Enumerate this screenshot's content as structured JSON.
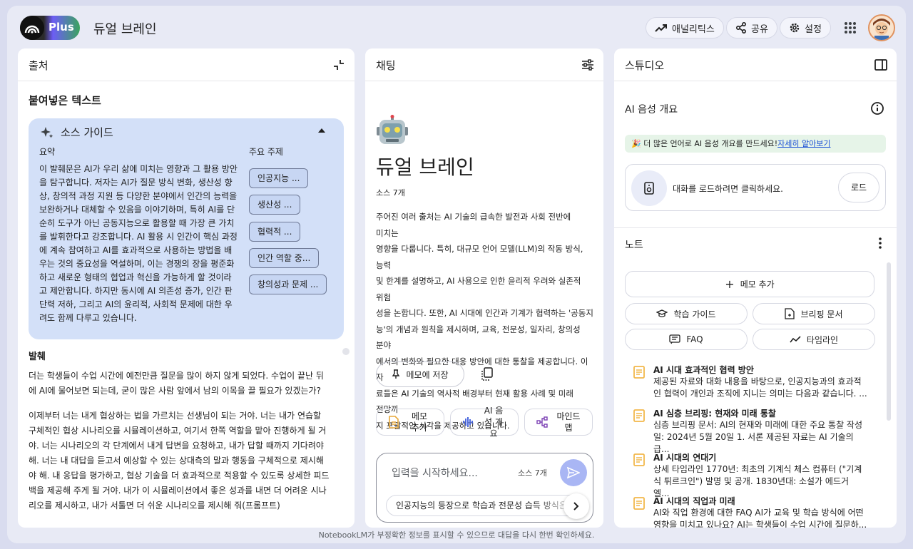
{
  "header": {
    "plan_badge": "Plus",
    "title": "듀얼 브레인",
    "analytics_label": "애널리틱스",
    "share_label": "공유",
    "settings_label": "설정"
  },
  "sources": {
    "panel_title": "출처",
    "pasted_title": "붙여넣은 텍스트",
    "guide_title": "소스 가이드",
    "summary_label": "요약",
    "topics_label": "주요 주제",
    "summary_lines": [
      "이 발췌문은 AI가 우리 삶에 미치는 영향과 그 활용 방안",
      "을 탐구합니다. 저자는 AI가 질문 방식 변화, 생산성 향",
      "상, 창의적 과정 지원 등 다양한 분야에서 인간의 능력을",
      "보완하거나 대체할 수 있음을 이야기하며, 특히 AI를 단",
      "순히 도구가 아닌 공동지능으로 활용할 때 가장 큰 가치",
      "를 발휘한다고 강조합니다. AI 활용 시 인간이 핵심 과정",
      "에 계속 참여하고 AI를 효과적으로 사용하는 방법을 배",
      "우는 것의 중요성을 역설하며, 이는 경쟁의 장을 평준화",
      "하고 새로운 형태의 협업과 혁신을 가능하게 할 것이라",
      "고 제안합니다. 하지만 동시에 AI 의존성 증가, 인간 판",
      "단력 저하, 그리고 AI의 윤리적, 사회적 문제에 대한 우",
      "려도 함께 다루고 있습니다."
    ],
    "topics": [
      "인공지능 ...",
      "생산성 ...",
      "협력적 ...",
      "인간 역할 중...",
      "창의성과 문제 ..."
    ],
    "body_label": "발췌",
    "body_paragraph_1": [
      "더는 학생들이 수업 시간에 예전만큼 질문을 많이 하지 않게 되었다. 수업이 끝난 뒤",
      "에 AI에 물어보면 되는데, 굳이 많은 사람 앞에서 남의 이목을 끌 필요가 있겠는가?"
    ],
    "body_paragraph_2": [
      "이제부터 너는 내게 협상하는 법을 가르치는 선생님이 되는 거야. 너는 내가 연습할",
      "구체적인 협상 시나리오를 시뮬레이션하고, 여기서 한쪽 역할을 맡아 진행하게 될 거",
      "야. 너는 시나리오의 각 단계에서 내게 답변을 요청하고, 내가 답할 때까지 기다려야",
      "해. 너는 내 대답을 듣고서 예상할 수 있는 상대측의 말과 행동을 구체적으로 제시해",
      "야 해. 내 응답을 평가하고, 협상 기술을 더 효과적으로 적용할 수 있도록 상세한 피드",
      "백을 제공해 주게 될 거야. 내가 이 시뮬레이션에서 좋은 성과를 내면 더 어려운 시나",
      "리오를 제시하고, 내가 서툴면 더 쉬운 시나리오를 제시해 줘(프롬프트)"
    ]
  },
  "chat": {
    "panel_title": "채팅",
    "notebook_title": "듀얼 브레인",
    "source_count": "소스 7개",
    "summary_lines": [
      "주어진 여러 출처는 AI 기술의 급속한 발전과 사회 전반에 미치는",
      "영향을 다룹니다. 특히, 대규모 언어 모델(LLM)의 작동 방식, 능력",
      "및 한계를 설명하고, AI 사용으로 인한 윤리적 우려와 실존적 위험",
      "성을 논합니다. 또한, AI 시대에 인간과 기계가 협력하는 '공동지",
      "능'의 개념과 원칙을 제시하며, 교육, 전문성, 일자리, 창의성 분야",
      "에서의 변화와 필요한 대응 방안에 대한 통찰을 제공합니다. 이 자",
      "료들은 AI 기술의 역사적 배경부터 현재 활용 사례 및 미래 전망까",
      "지 포괄적인 시각을 제공하고 있습니다."
    ],
    "save_memo_label": "메모에 저장",
    "actions": [
      "메모 추가",
      "AI 음성 개요",
      "마인드맵"
    ],
    "input_placeholder": "입력을 시작하세요...",
    "input_source_count": "소스 7개",
    "suggestion": "인공지능의 등장으로 학습과 전문성 습득 방식은"
  },
  "studio": {
    "panel_title": "스튜디오",
    "audio_title": "AI 음성 개요",
    "promo_text": "더 많은 언어로 AI 음성 개요를 만드세요!",
    "promo_link": "자세히 알아보기",
    "load_text": "대화를 로드하려면 클릭하세요.",
    "load_button": "로드",
    "notes_title": "노트",
    "add_memo_label": "메모 추가",
    "chips": [
      "학습 가이드",
      "브리핑 문서",
      "FAQ",
      "타임라인"
    ],
    "notes": [
      {
        "title": "AI 시대 효과적인 협력 방안",
        "desc": [
          "제공된 자료와 대화 내용을 바탕으로, 인공지능과의 효과적",
          "인 협력이 개인과 조직에 지니는 의미는 다음과 같습니다. ..."
        ]
      },
      {
        "title": "AI 심층 브리핑: 현재와 미래 통찰",
        "desc": [
          "심층 브리핑 문서: AI의 현재와 미래에 대한 주요 통찰 작성",
          "일: 2024년 5월 20일 1. 서론 제공된 자료는 AI 기술의 급..."
        ]
      },
      {
        "title": "AI 시대의 연대기",
        "desc": [
          "상세 타임라인 1770년: 최초의 기계식 체스 컴퓨터 (\"기계",
          "식 튀르크인\") 발명 및 공개. 1830년대: 소설가 에드거 엘..."
        ]
      },
      {
        "title": "AI 시대의 직업과 미래",
        "desc": [
          "AI와 직업 환경에 대한 FAQ AI가 교육 및 학습 방식에 어떤",
          "영향을 미치고 있나요? AI는 학생들이 수업 시간에 질문하..."
        ]
      }
    ]
  },
  "footer": "NotebookLM가 부정확한 정보를 표시할 수 있으므로 대답을 다시 한번 확인하세요.",
  "colors": {
    "guide_bg": "#d3e0f8",
    "send_btn": "#a9b6f4",
    "promo_bg": "#e6f4e8",
    "note_icon": "#f2b84b"
  }
}
